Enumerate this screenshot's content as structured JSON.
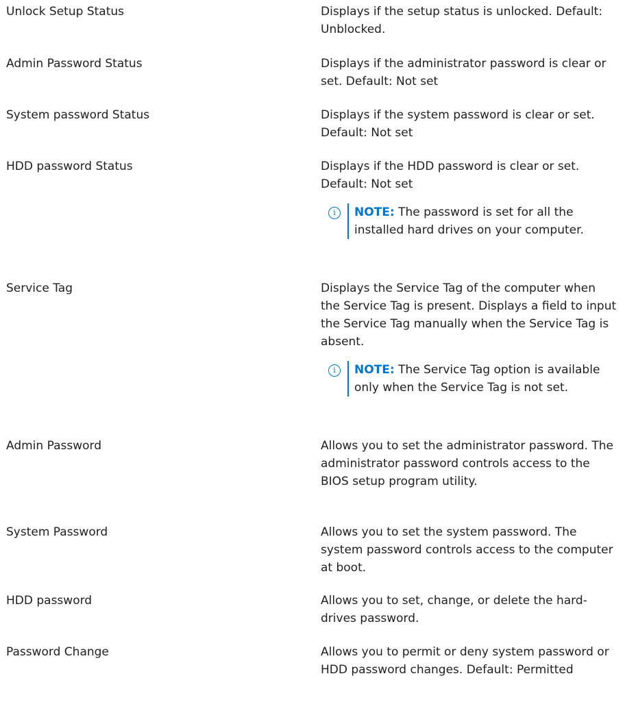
{
  "rows": [
    {
      "option": "Unlock Setup Status",
      "desc": "Displays if the setup status is unlocked. Default: Unblocked."
    },
    {
      "option": "Admin Password Status",
      "desc": "Displays if the administrator password is clear or set. Default: Not set"
    },
    {
      "option": "System password Status",
      "desc": "Displays if the system password is clear or set. Default: Not set"
    },
    {
      "option": "HDD password Status",
      "desc": "Displays if the HDD password is clear or set. Default: Not set",
      "note_label": "NOTE:",
      "note_text": "The password is set for all the installed hard drives on your computer."
    },
    {
      "option": "Service Tag",
      "desc": "Displays the Service Tag of the computer when the Service Tag is present. Displays a field to input the Service Tag manually when the Service Tag is absent.",
      "note_label": "NOTE:",
      "note_text": "The Service Tag option is available only when the Service Tag is not set."
    },
    {
      "option": "Admin Password",
      "desc": "Allows you to set the administrator password. The administrator password controls access to the BIOS setup program utility."
    },
    {
      "option": "System Password",
      "desc": "Allows you to set the system password. The system password controls access to the computer at boot."
    },
    {
      "option": "HDD password",
      "desc": "Allows you to set, change, or delete the hard-drives password."
    },
    {
      "option": "Password Change",
      "desc": "Allows you to permit or deny system password or HDD password changes. Default: Permitted"
    }
  ],
  "icons": {
    "note": "info-icon",
    "note_glyph": "i"
  },
  "colors": {
    "accent": "#0076ce",
    "text": "#1f1f1f"
  }
}
